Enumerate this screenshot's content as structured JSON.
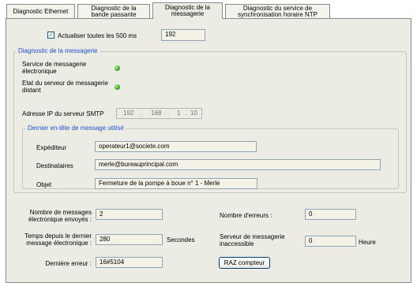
{
  "tabs": [
    {
      "label": "Diagnostic Ethernet"
    },
    {
      "label": "Diagnostic de la\nbande passante"
    },
    {
      "label": "Diagnostic de la\nmessagerie"
    },
    {
      "label": "Diagnostic du service de\nsynchronisation horaire NTP"
    }
  ],
  "refresh": {
    "checkbox_label": "Actualiser toutes les 500 ms",
    "checked": true,
    "value": "192"
  },
  "messaging": {
    "legend": "Diagnostic de la messagerie",
    "service_label": "Service de messagerie\nélectronique",
    "remote_label": "Etat du serveur de messagerie\ndistant",
    "smtp_label": "Adresse IP du serveur SMTP",
    "ip": [
      "192",
      "168",
      "1",
      "10"
    ],
    "ip_dot": "."
  },
  "header": {
    "legend": "Dernier en-tête de message utilisé",
    "sender_label": "Expéditeur",
    "sender": "operateur1@societe.com",
    "recipients_label": "Destinataires",
    "recipients": "merle@bureauprincipal.com",
    "subject_label": "Objet",
    "subject": "Fermeture de la pompe à boue n° 1 - Merle"
  },
  "stats": {
    "sent_label": "Nombre de messages\nélectronique envoyés :",
    "sent": "2",
    "errors_label": "Nombre d'erreurs :",
    "errors": "0",
    "time_label": "Temps depuis le dernier\nmessage électronique :",
    "time": "280",
    "seconds_unit": "Secondes",
    "server_label": "Serveur de messagerie\ninaccessible",
    "server_value": "0",
    "hour_unit": "Heure",
    "last_error_label": "Dernière erreur :",
    "last_error": "16#5104",
    "reset_button": "RAZ compteur"
  }
}
